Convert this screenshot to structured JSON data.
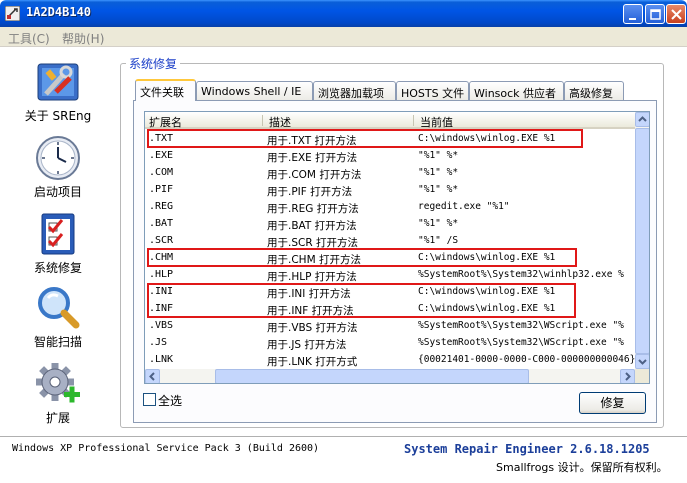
{
  "window": {
    "title": "1A2D4B140"
  },
  "menu": [
    {
      "label": "工具(C)"
    },
    {
      "label": "帮助(H)"
    }
  ],
  "nav": [
    {
      "label": "关于 SREng",
      "icon": "tools-icon"
    },
    {
      "label": "启动项目",
      "icon": "clock-icon"
    },
    {
      "label": "系统修复",
      "icon": "checklist-icon"
    },
    {
      "label": "智能扫描",
      "icon": "magnifier-icon"
    },
    {
      "label": "扩展",
      "icon": "gear-plus-icon"
    }
  ],
  "group": {
    "title": "系统修复"
  },
  "tabs": [
    {
      "label": "文件关联"
    },
    {
      "label": "Windows Shell / IE"
    },
    {
      "label": "浏览器加载项"
    },
    {
      "label": "HOSTS 文件"
    },
    {
      "label": "Winsock 供应者"
    },
    {
      "label": "高级修复"
    }
  ],
  "list": {
    "columns": [
      "扩展名",
      "描述",
      "当前值"
    ],
    "rows": [
      {
        "ext": ".TXT",
        "desc": "用于.TXT 打开方法",
        "value": "C:\\windows\\winlog.EXE %1"
      },
      {
        "ext": ".EXE",
        "desc": "用于.EXE 打开方法",
        "value": "\"%1\" %*"
      },
      {
        "ext": ".COM",
        "desc": "用于.COM 打开方法",
        "value": "\"%1\" %*"
      },
      {
        "ext": ".PIF",
        "desc": "用于.PIF 打开方法",
        "value": "\"%1\" %*"
      },
      {
        "ext": ".REG",
        "desc": "用于.REG 打开方法",
        "value": "regedit.exe \"%1\""
      },
      {
        "ext": ".BAT",
        "desc": "用于.BAT 打开方法",
        "value": "\"%1\" %*"
      },
      {
        "ext": ".SCR",
        "desc": "用于.SCR 打开方法",
        "value": "\"%1\" /S"
      },
      {
        "ext": ".CHM",
        "desc": "用于.CHM 打开方法",
        "value": "C:\\windows\\winlog.EXE %1"
      },
      {
        "ext": ".HLP",
        "desc": "用于.HLP 打开方法",
        "value": "%SystemRoot%\\System32\\winhlp32.exe %"
      },
      {
        "ext": ".INI",
        "desc": "用于.INI 打开方法",
        "value": "C:\\windows\\winlog.EXE %1"
      },
      {
        "ext": ".INF",
        "desc": "用于.INF 打开方法",
        "value": "C:\\windows\\winlog.EXE %1"
      },
      {
        "ext": ".VBS",
        "desc": "用于.VBS 打开方法",
        "value": "%SystemRoot%\\System32\\WScript.exe \"%"
      },
      {
        "ext": ".JS",
        "desc": "用于.JS 打开方法",
        "value": "%SystemRoot%\\System32\\WScript.exe \"%"
      },
      {
        "ext": ".LNK",
        "desc": "用于.LNK 打开方式",
        "value": "{00021401-0000-0000-C000-000000000046}"
      }
    ]
  },
  "select_all_label": "全选",
  "repair_label": "修复",
  "status": {
    "os": "Windows XP Professional Service Pack 3 (Build 2600)",
    "product": "System Repair Engineer 2.6.18.1205",
    "copyright": "Smallfrogs 设计。保留所有权利。"
  },
  "colors": {
    "highlight": "#e01818",
    "accent": "#1c3fc8",
    "titlebar": "#0055e5"
  }
}
